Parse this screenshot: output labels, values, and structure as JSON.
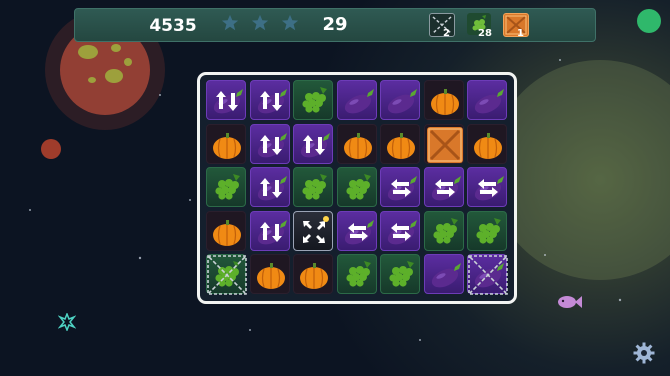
{
  "hud": {
    "score": "4535",
    "moves_left": "29",
    "stars": {
      "total": 3,
      "earned": 0
    },
    "goals": [
      {
        "icon": "chain-icon",
        "count": "2"
      },
      {
        "icon": "grapes-icon",
        "count": "28"
      },
      {
        "icon": "crate-icon",
        "count": "1"
      }
    ]
  },
  "board": {
    "rows": 5,
    "cols": 7,
    "tiles": [
      [
        "vertical-striped-eggplant",
        "vertical-striped-eggplant",
        "grapes",
        "eggplant",
        "eggplant",
        "pumpkin",
        "eggplant"
      ],
      [
        "pumpkin",
        "vertical-striped-eggplant",
        "vertical-striped-eggplant",
        "pumpkin",
        "pumpkin",
        "crate",
        "pumpkin"
      ],
      [
        "grapes",
        "vertical-striped-eggplant",
        "grapes",
        "grapes",
        "horizontal-striped-eggplant",
        "horizontal-striped-eggplant",
        "horizontal-striped-eggplant"
      ],
      [
        "pumpkin",
        "vertical-striped-eggplant",
        "bomb",
        "horizontal-striped-eggplant",
        "horizontal-striped-eggplant",
        "grapes",
        "grapes"
      ],
      [
        "chained-grapes",
        "pumpkin",
        "pumpkin",
        "grapes",
        "grapes",
        "eggplant",
        "chained-eggplant"
      ]
    ]
  },
  "colors": {
    "pumpkin": "#f08a14",
    "eggplant": "#5b2a8f",
    "grapes": "#5db02a",
    "crate": "#d9782a",
    "hud_bar": "#2f5a53",
    "pause_button": "#2fb86b"
  }
}
